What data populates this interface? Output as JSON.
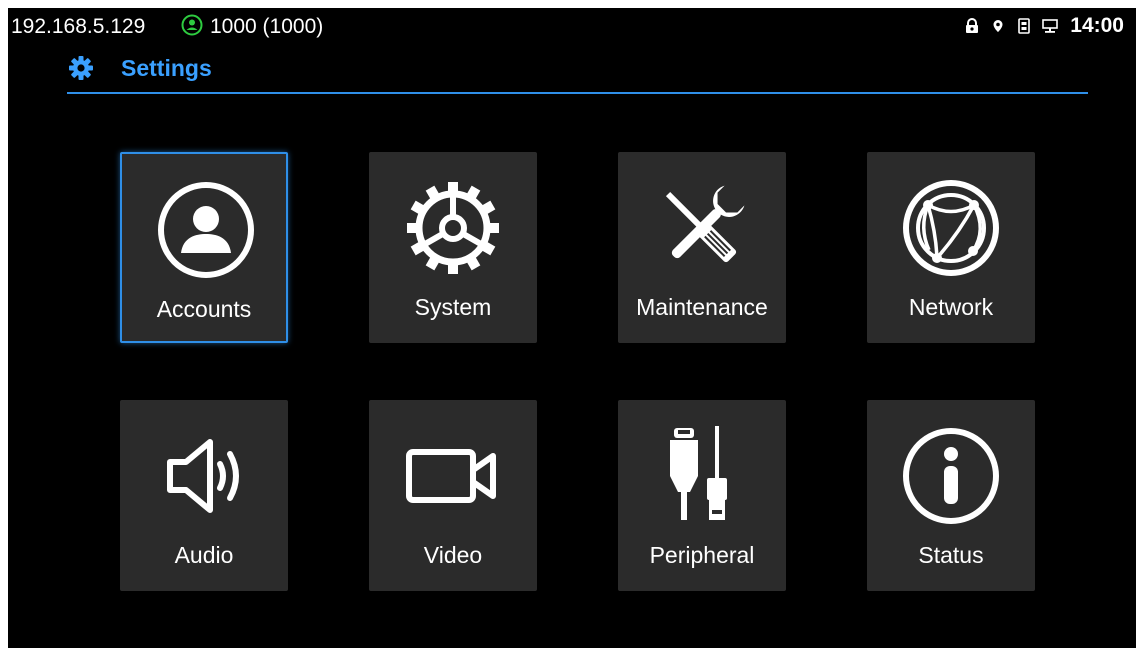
{
  "status_bar": {
    "ip": "192.168.5.129",
    "account": "1000 (1000)",
    "account_icon": "account-status-icon",
    "account_color": "#2ecc40",
    "right_icons": [
      "lock-icon",
      "location-icon",
      "sim-icon",
      "ethernet-icon"
    ],
    "time": "14:00"
  },
  "header": {
    "title": "Settings",
    "icon": "gear-icon",
    "accent_color": "#3aa0ff"
  },
  "tiles": [
    {
      "label": "Accounts",
      "icon": "account-icon",
      "selected": true
    },
    {
      "label": "System",
      "icon": "gear-icon"
    },
    {
      "label": "Maintenance",
      "icon": "tools-icon"
    },
    {
      "label": "Network",
      "icon": "globe-icon"
    },
    {
      "label": "Audio",
      "icon": "speaker-icon"
    },
    {
      "label": "Video",
      "icon": "video-camera-icon"
    },
    {
      "label": "Peripheral",
      "icon": "plug-usb-icon"
    },
    {
      "label": "Status",
      "icon": "info-icon"
    }
  ]
}
